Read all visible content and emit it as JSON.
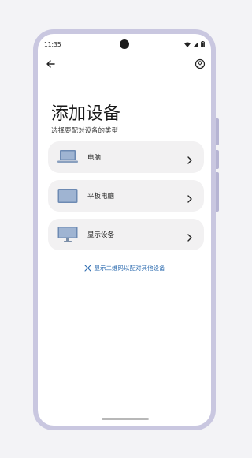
{
  "status_bar": {
    "time": "11:35"
  },
  "header": {
    "title": "添加设备",
    "subtitle": "选择要配对设备的类型"
  },
  "devices": [
    {
      "label": "电脑",
      "icon": "laptop-icon"
    },
    {
      "label": "平板电脑",
      "icon": "tablet-icon"
    },
    {
      "label": "显示设备",
      "icon": "monitor-icon"
    }
  ],
  "qr_link": {
    "label": "显示二维码以配对其他设备",
    "icon": "qr-icon"
  },
  "colors": {
    "accent": "#2f6db0",
    "card": "#f2f1f2",
    "frame": "#c9c7e0",
    "device": "#6d8ab3"
  }
}
